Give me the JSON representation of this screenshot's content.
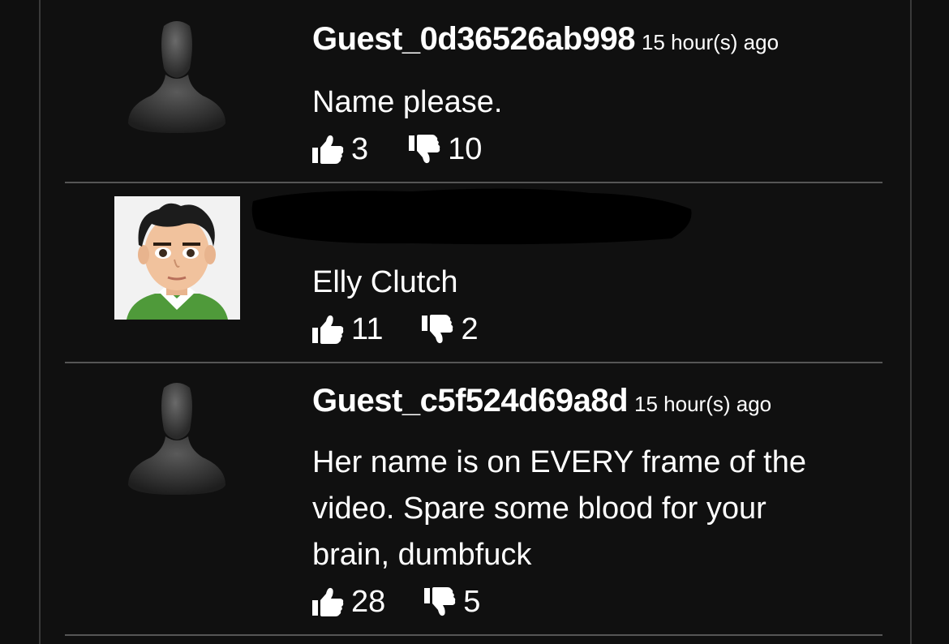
{
  "comments": [
    {
      "author": "Guest_0d36526ab998",
      "time": "15 hour(s) ago",
      "text": "Name please.",
      "likes": "3",
      "dislikes": "10",
      "avatar": "guest-silhouette-icon"
    },
    {
      "author": "",
      "time": "",
      "text": "Elly Clutch",
      "likes": "11",
      "dislikes": "2",
      "avatar": "cartoon-man-avatar"
    },
    {
      "author": "Guest_c5f524d69a8d",
      "time": "15 hour(s) ago",
      "text": "Her name is on EVERY frame of the video. Spare some blood for your brain, dumbfuck",
      "likes": "28",
      "dislikes": "5",
      "avatar": "guest-silhouette-icon"
    }
  ],
  "colors": {
    "background": "#0f0f0f",
    "divider": "#565656",
    "border": "#3a3a3a",
    "text": "#ffffff"
  }
}
